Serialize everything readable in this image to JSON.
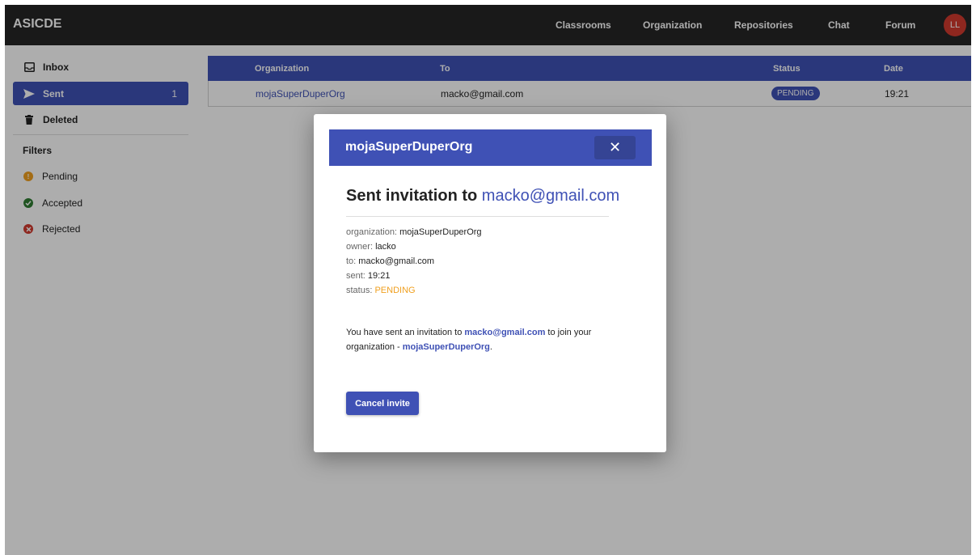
{
  "app": {
    "brand": "ASICDE"
  },
  "nav": {
    "links": [
      "Classrooms",
      "Organization",
      "Repositories",
      "Chat",
      "Forum"
    ],
    "avatar": "LL"
  },
  "sidebar": {
    "items": [
      {
        "label": "Inbox",
        "icon": "inbox-icon"
      },
      {
        "label": "Sent",
        "icon": "send-icon",
        "count": "1"
      },
      {
        "label": "Deleted",
        "icon": "trash-icon"
      }
    ],
    "filters_label": "Filters",
    "filters": [
      {
        "label": "Pending",
        "icon": "pending-icon",
        "color": "#f0a020"
      },
      {
        "label": "Accepted",
        "icon": "check-circle-icon",
        "color": "#2e7d32"
      },
      {
        "label": "Rejected",
        "icon": "x-circle-icon",
        "color": "#d23a2e"
      }
    ]
  },
  "table": {
    "columns": [
      "Organization",
      "To",
      "Status",
      "Date"
    ],
    "rows": [
      {
        "organization": "mojaSuperDuperOrg",
        "to": "macko@gmail.com",
        "status": "PENDING",
        "date": "19:21"
      }
    ]
  },
  "modal": {
    "header": "mojaSuperDuperOrg",
    "close_symbol": "✕",
    "title_prefix": "Sent invitation to",
    "title_email": "macko@gmail.com",
    "info": [
      {
        "label": "organization:",
        "value": "mojaSuperDuperOrg"
      },
      {
        "label": "owner:",
        "value": "lacko"
      },
      {
        "label": "to:",
        "value": "macko@gmail.com"
      },
      {
        "label": "sent:",
        "value": "19:21"
      },
      {
        "label": "status:",
        "value": "PENDING"
      }
    ],
    "message": {
      "part1": "You have sent an invitation to",
      "email": "macko@gmail.com",
      "part2": "to join your organization -",
      "org": "mojaSuperDuperOrg",
      "end": "."
    },
    "cancel_label": "Cancel invite"
  },
  "colors": {
    "primary": "#3f51b5",
    "topbar": "#262626",
    "pending": "#f0a020",
    "avatar": "#d23a2e"
  }
}
